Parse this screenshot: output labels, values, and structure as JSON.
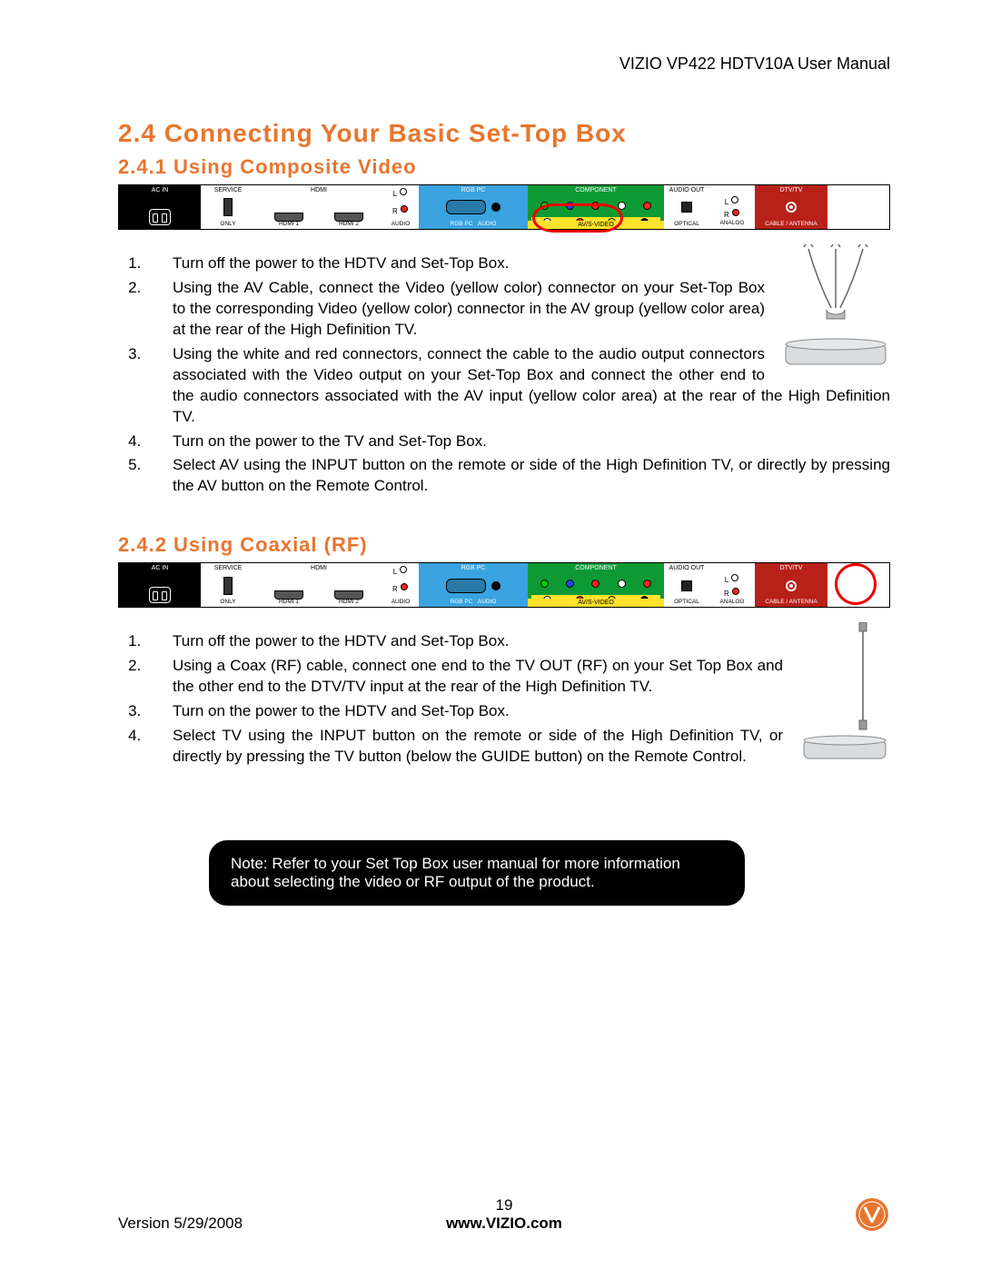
{
  "header": {
    "product_line": "VIZIO VP422 HDTV10A User Manual"
  },
  "section": {
    "h1": "2.4 Connecting Your Basic Set-Top Box",
    "s1": {
      "h2": "2.4.1 Using Composite Video",
      "steps": [
        "Turn off the power to the HDTV and Set-Top Box.",
        "Using the AV Cable, connect the Video (yellow color) connector on your Set-Top Box to the corresponding Video (yellow color) connector in the AV group (yellow color area) at the rear of the High Definition TV.",
        "Using the white and red connectors, connect the cable to the audio output connectors associated with the Video output on your Set-Top Box and connect the other end to the audio connectors associated with the AV input (yellow color area) at the rear  of the High Definition TV.",
        "Turn on the power to the TV and Set-Top Box.",
        "Select AV using the INPUT button on the remote or side of the High Definition TV, or directly by pressing the AV button on the Remote Control."
      ]
    },
    "s2": {
      "h2": "2.4.2 Using Coaxial (RF)",
      "steps": [
        "Turn off the power to the HDTV and Set-Top Box.",
        "Using a Coax (RF) cable, connect one end to the TV OUT (RF) on your Set Top Box and the other end to the DTV/TV input at the rear of the High Definition TV.",
        "Turn on the power to the HDTV and Set-Top Box.",
        "Select TV using the INPUT button on the remote or side of the High Definition TV, or directly by pressing the TV button (below the GUIDE button) on the Remote Control."
      ]
    },
    "note": "Note: Refer to your Set Top Box user manual for more information about selecting the video or RF output of the product."
  },
  "panel_labels": {
    "ac": "AC IN",
    "service_top": "SERVICE",
    "service_bot": "ONLY",
    "hdmi_top": "HDMI",
    "hdmi1": "HDMI 1",
    "hdmi2": "HDMI 2",
    "L": "L",
    "R": "R",
    "audio": "AUDIO",
    "rgb_top": "RGB PC",
    "rgb_bot": "RGB PC",
    "rgb_audio": "AUDIO",
    "component": "COMPONENT",
    "av": "AV/S-VIDEO",
    "audio_out": "AUDIO OUT",
    "optical": "OPTICAL",
    "analog": "ANALOG",
    "dtv": "DTV/TV",
    "cable": "CABLE / ANTENNA"
  },
  "footer": {
    "version": "Version 5/29/2008",
    "page": "19",
    "url": "www.VIZIO.com"
  }
}
